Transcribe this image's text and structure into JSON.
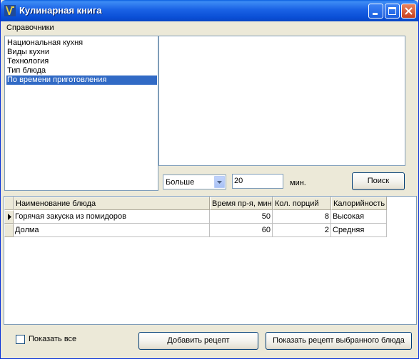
{
  "window": {
    "title": "Кулинарная книга"
  },
  "menu": {
    "items": [
      "Справочники"
    ]
  },
  "categories": {
    "items": [
      "Национальная кухня",
      "Виды кухни",
      "Технология",
      "Тип блюда",
      "По времени приготовления"
    ],
    "selected_index": 4
  },
  "filter": {
    "comparison": "Больше",
    "value": "20",
    "units": "мин.",
    "search_label": "Поиск"
  },
  "grid": {
    "columns": [
      "Наименование блюда",
      "Время пр-я, мин",
      "Кол. порций",
      "Калорийность"
    ],
    "rows": [
      {
        "name": "Горячая закуска из помидоров",
        "time": "50",
        "portions": "8",
        "calories": "Высокая"
      },
      {
        "name": "Долма",
        "time": "60",
        "portions": "2",
        "calories": "Средняя"
      }
    ],
    "current_row": 0
  },
  "footer": {
    "show_all_label": "Показать все",
    "show_all_checked": false,
    "add_label": "Добавить рецепт",
    "show_recipe_label": "Показать рецепт выбранного блюда"
  },
  "colors": {
    "selection": "#316ac5",
    "titlebar": "#0a4fd6"
  }
}
